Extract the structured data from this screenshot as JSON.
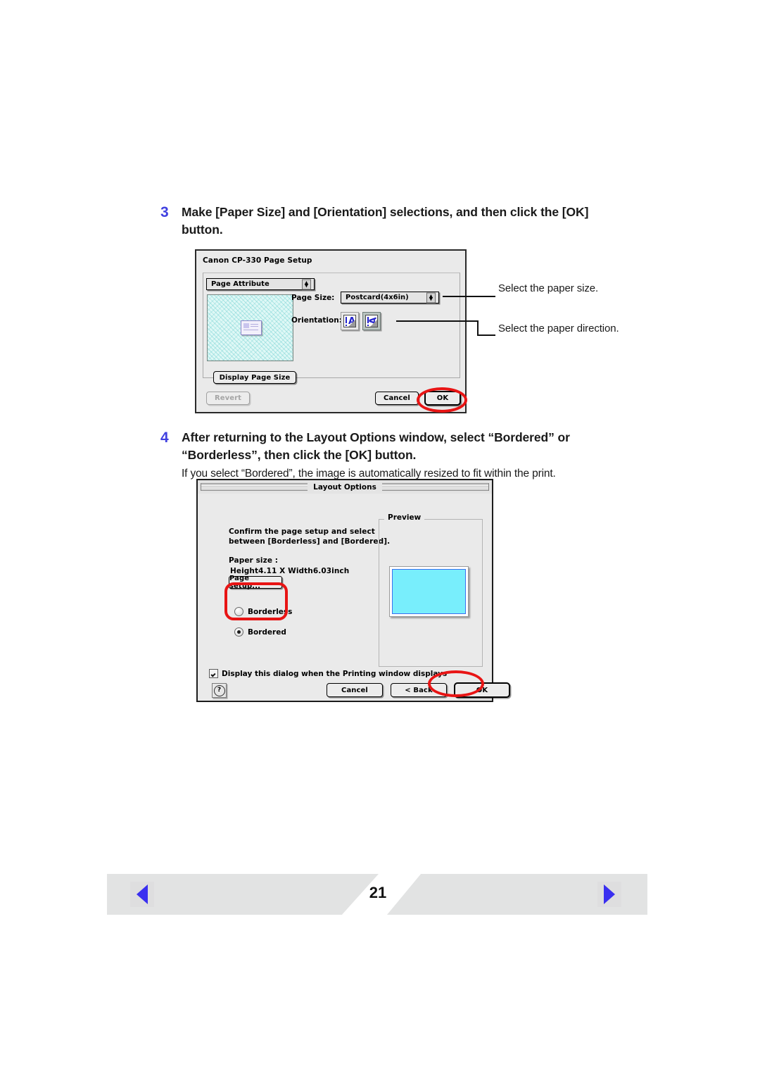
{
  "page": {
    "number": "21"
  },
  "steps": [
    {
      "number": "3",
      "title": "Make [Paper Size] and [Orientation] selections, and then click the [OK] button.",
      "subtitle": ""
    },
    {
      "number": "4",
      "title": "After returning to the Layout Options window, select “Bordered” or “Borderless”, then click the [OK] button.",
      "subtitle": "If you select “Bordered”, the image is automatically resized to fit within the print."
    }
  ],
  "page_setup_dialog": {
    "title": "Canon CP-330 Page Setup",
    "attribute_popup_value": "Page Attribute",
    "page_size_label": "Page Size:",
    "page_size_value": "Postcard(4x6in)",
    "orientation_label": "Orientation:",
    "orientation_portrait_glyph": "A",
    "orientation_landscape_glyph": "A",
    "display_page_size_label": "Display Page Size",
    "revert_label": "Revert",
    "cancel_label": "Cancel",
    "ok_label": "OK"
  },
  "callouts": {
    "paper_size": "Select the paper size.",
    "paper_direction": "Select the paper direction."
  },
  "layout_options_dialog": {
    "title": "Layout Options",
    "instruction": "Confirm the page setup and select between [Borderless] and [Bordered].",
    "paper_size_label": "Paper size :",
    "paper_size_value": "Height4.11 X Width6.03inch",
    "page_setup_button": "Page setup...",
    "radio_borderless": "Borderless",
    "radio_bordered": "Bordered",
    "selected_radio": "Bordered",
    "preview_legend": "Preview",
    "display_dialog_checkbox": "Display this dialog when the Printing window displays",
    "display_dialog_checked": true,
    "help_glyph": "?",
    "cancel_label": "Cancel",
    "back_label": "< Back",
    "ok_label": "OK"
  },
  "footer": {
    "prev_icon": "triangle-left-icon",
    "next_icon": "triangle-right-icon"
  },
  "colors": {
    "step_number": "#4040e0",
    "highlight_red": "#e81414",
    "preview_image": "#78eefc",
    "nav_arrow": "#3a2ff0"
  }
}
